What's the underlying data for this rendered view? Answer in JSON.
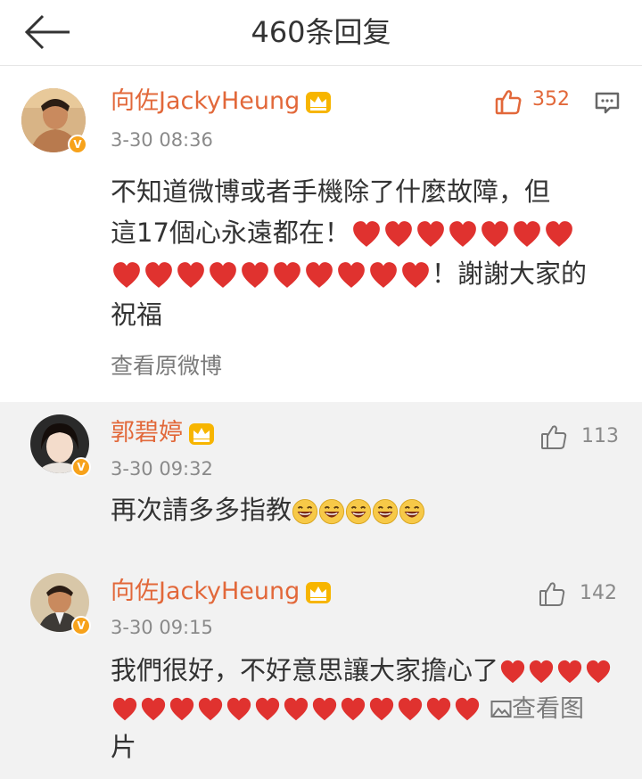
{
  "header": {
    "title": "460条回复"
  },
  "post": {
    "author": "向佐JackyHeung",
    "time": "3-30 08:36",
    "likes": "352",
    "text_line1": "不知道微博或者手機除了什麼故障，但",
    "text_line2": "這17個心永遠都在！",
    "text_line3_suffix": "！謝謝大家的",
    "text_line4": "祝福",
    "view_original": "查看原微博",
    "badge": "V"
  },
  "reply1": {
    "author": "郭碧婷",
    "time": "3-30 09:32",
    "likes": "113",
    "text": "再次請多多指教",
    "badge": "V"
  },
  "reply2": {
    "author": "向佐JackyHeung",
    "time": "3-30 09:15",
    "likes": "142",
    "text_line1": "我們很好，不好意思讓大家擔心了",
    "view_image": "查看图",
    "text_line3": "片",
    "badge": "V"
  },
  "colors": {
    "accent": "#e2683a",
    "heart": "#e0322f",
    "badge": "#f7a21b",
    "reply_bg": "#f2f2f2"
  },
  "icons": [
    "back-arrow-icon",
    "crown-icon",
    "thumbs-up-icon",
    "comment-icon",
    "heart-emoji-icon",
    "laughing-emoji-icon",
    "image-icon"
  ]
}
